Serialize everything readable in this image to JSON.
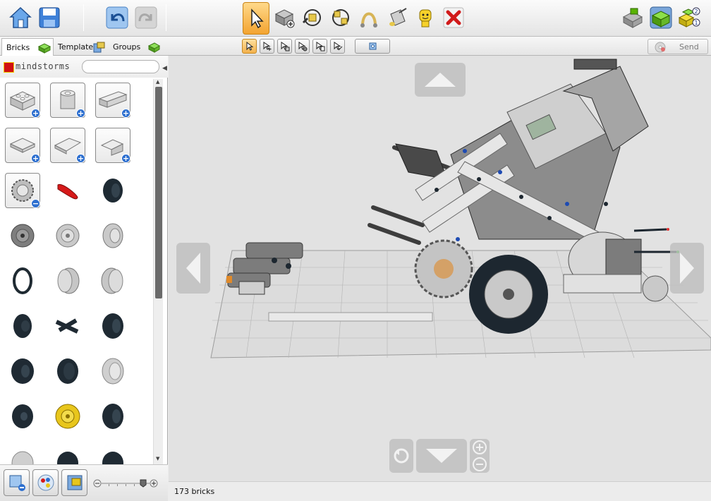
{
  "toolbar": {
    "buttons": [
      {
        "id": "home",
        "icon": "home-icon"
      },
      {
        "id": "save",
        "icon": "save-icon"
      },
      {
        "id": "undo",
        "icon": "undo-icon"
      },
      {
        "id": "redo",
        "icon": "redo-icon"
      },
      {
        "id": "select",
        "icon": "cursor-icon",
        "active": true
      },
      {
        "id": "clone",
        "icon": "clone-brick-icon"
      },
      {
        "id": "hinge",
        "icon": "hinge-icon"
      },
      {
        "id": "hinge-align",
        "icon": "hinge-align-icon"
      },
      {
        "id": "flex",
        "icon": "flex-icon"
      },
      {
        "id": "paint",
        "icon": "paint-bucket-icon"
      },
      {
        "id": "hide",
        "icon": "minifig-hide-icon"
      },
      {
        "id": "delete",
        "icon": "delete-icon"
      },
      {
        "id": "view-mode",
        "icon": "view-mode-icon"
      },
      {
        "id": "build-mode",
        "icon": "build-mode-icon"
      },
      {
        "id": "instructions-mode",
        "icon": "instructions-mode-icon"
      }
    ]
  },
  "tabs": [
    {
      "label": "Bricks",
      "icon": "brick-icon",
      "selected": true
    },
    {
      "label": "Templates",
      "icon": "templates-icon"
    },
    {
      "label": "Groups",
      "icon": "groups-icon"
    }
  ],
  "selection_tools": [
    {
      "icon": "single-select-icon",
      "active": true
    },
    {
      "icon": "multi-select-icon"
    },
    {
      "icon": "connected-select-icon"
    },
    {
      "icon": "same-color-select-icon"
    },
    {
      "icon": "same-shape-select-icon"
    },
    {
      "icon": "invert-select-icon"
    },
    {
      "icon": "camera-reset-icon"
    }
  ],
  "send": {
    "label": "Send",
    "icon": "send-disc-icon"
  },
  "palette": {
    "brand": "mindstorms",
    "search_placeholder": "",
    "items": [
      "brick-2x2-icon",
      "round-brick-icon",
      "brick-1x4-icon",
      "plate-2x2-icon",
      "plate-wedge-icon",
      "plate-angle-icon",
      "gear-tire-icon",
      "red-axle-icon",
      "black-tire-icon",
      "hub-dark-icon",
      "hub-light-icon",
      "hub-wide-icon",
      "rubber-band-icon",
      "wide-hub-light-icon",
      "wide-hub-light2-icon",
      "black-hub-icon",
      "tread-link-icon",
      "black-tire2-icon",
      "black-tire3-icon",
      "black-hub2-icon",
      "grey-hub3-icon",
      "black-tire4-icon",
      "yellow-hub-icon",
      "black-tire5-icon",
      "grey-hub4-icon",
      "black-tire6-icon",
      "black-tire7-icon"
    ]
  },
  "status": {
    "brick_count": "173 bricks"
  },
  "colors": {
    "accent": "#f3a431",
    "palette_bg": "#ffffff",
    "canvas_bg": "#e2e2e2"
  }
}
